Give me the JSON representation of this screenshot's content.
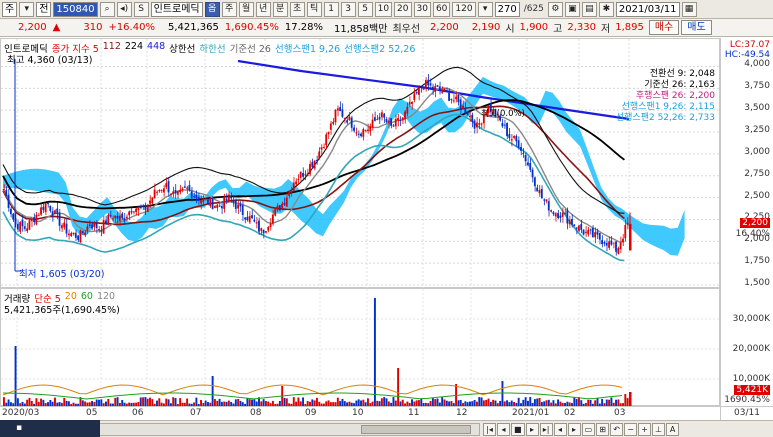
{
  "toolbar": {
    "market": "주",
    "code_label": "전",
    "code": "150840",
    "stock_name": "인트로메딕",
    "btn_option": "옵",
    "periods": [
      "주",
      "월",
      "년",
      "분",
      "초",
      "틱"
    ],
    "intervals": [
      "1",
      "3",
      "5",
      "10",
      "20",
      "30",
      "60",
      "120"
    ],
    "count": "270",
    "total": "/625",
    "date": "2021/03/11"
  },
  "quote": {
    "price": "2,200",
    "change_arrow": "▲",
    "change": "310",
    "change_pct": "+16.40%",
    "volume": "5,421,365",
    "volume_pct": "1,690.45%",
    "turnover_pct": "17.28%",
    "amount": "11,858백만",
    "priority_sell_label": "최우선",
    "priority_sell": "2,200",
    "priority_buy": "2,190",
    "open_label": "시",
    "open": "1,900",
    "high_label": "고",
    "high": "2,330",
    "low_label": "저",
    "low": "1,895",
    "buy_btn": "매수",
    "sell_btn": "매도"
  },
  "price_legend": {
    "name": "인트로메딕",
    "ma": "종가 지수 5",
    "ma112": "112",
    "ma224": "224",
    "ma448": "448",
    "upper": "상한선",
    "lower": "하한선",
    "base": "기준선 26",
    "span1": "선행스팬1 9,26",
    "span2": "선행스팬2 52,26"
  },
  "price_annotations": {
    "high_mark": "최고 4,360 (03/13)",
    "low_mark": "최저 1,605 (03/20)",
    "center_mark": "최고(0.0%)",
    "lc": "LC:37.07",
    "hc": "HC:-49.54",
    "ichimoku": [
      "전환선 9: 2,048",
      "기준선 26: 2,163",
      "후행스팬 26: 2,200",
      "선행스팬1 9,26: 2,115",
      "선행스팬2 52,26: 2,733"
    ],
    "cur_price": "2,200",
    "cur_pct": "16.40%"
  },
  "price_axis": [
    "4,000",
    "3,750",
    "3,500",
    "3,250",
    "3,000",
    "2,750",
    "2,500",
    "2,250",
    "2,000",
    "1,750",
    "1,500"
  ],
  "volume_legend": {
    "label": "거래량",
    "ma": "단순 5",
    "ma20": "20",
    "ma60": "60",
    "ma120": "120",
    "value": "5,421,365주(1,690.45%)"
  },
  "volume_axis": [
    "30,000K",
    "20,000K",
    "10,000K"
  ],
  "volume_cur": "5,421K",
  "volume_cur_pct": "1690.45%",
  "date_axis": [
    "2020/03",
    "05",
    "06",
    "07",
    "08",
    "09",
    "10",
    "11",
    "12",
    "2021/01",
    "02",
    "03"
  ],
  "date_corner": "03/11",
  "colors": {
    "up": "#e00000",
    "down": "#0030c8",
    "cloud": "#1ec0ff",
    "ma448": "#1a1ae0",
    "ma224": "#000000",
    "ma112": "#8b1010",
    "bollinger": "#30a8b8",
    "base_line": "#888888"
  },
  "chart_data": {
    "type": "candlestick",
    "ylim": [
      1500,
      4200
    ],
    "x": [
      "2020/03",
      "05",
      "06",
      "07",
      "08",
      "09",
      "10",
      "11",
      "12",
      "2021/01",
      "02",
      "03"
    ],
    "close_path": [
      2600,
      2200,
      2150,
      2300,
      2450,
      2250,
      2100,
      2050,
      2200,
      2150,
      2300,
      2250,
      2400,
      2350,
      2550,
      2650,
      2500,
      2600,
      2500,
      2450,
      2400,
      2500,
      2350,
      2250,
      2100,
      2300,
      2450,
      2700,
      2800,
      2950,
      3200,
      3500,
      3400,
      3250,
      3300,
      3450,
      3300,
      3400,
      3600,
      3800,
      3750,
      3700,
      3600,
      3500,
      3300,
      3550,
      3400,
      3200,
      3100,
      2800,
      2500,
      2350,
      2300,
      2200,
      2100,
      2050,
      2000,
      1900,
      2200
    ]
  }
}
